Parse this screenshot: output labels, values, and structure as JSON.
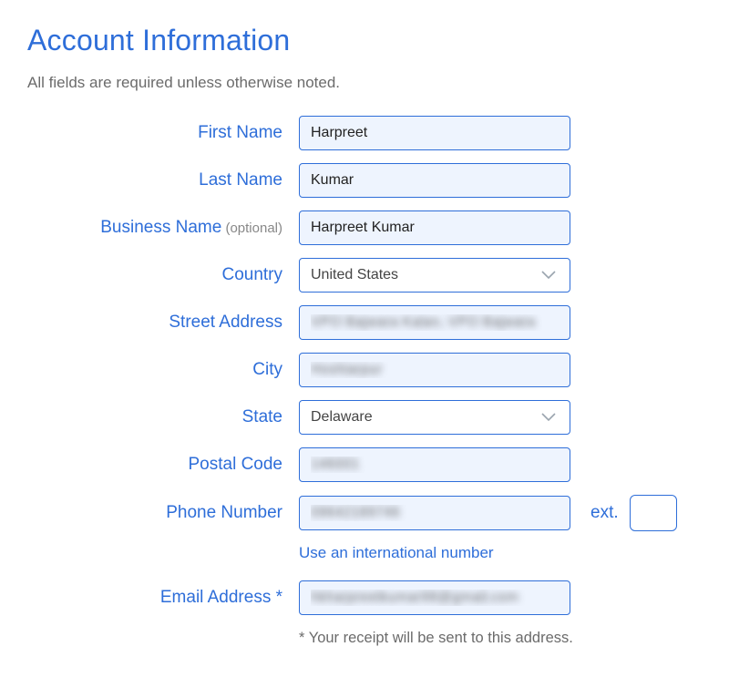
{
  "heading": "Account Information",
  "subheading": "All fields are required unless otherwise noted.",
  "labels": {
    "first_name": "First Name",
    "last_name": "Last Name",
    "business_name": "Business Name",
    "business_optional": " (optional)",
    "country": "Country",
    "street": "Street Address",
    "city": "City",
    "state": "State",
    "postal": "Postal Code",
    "phone": "Phone Number",
    "ext": "ext.",
    "intl_link": "Use an international number",
    "email": "Email Address *",
    "email_note": "* Your receipt will be sent to this address."
  },
  "values": {
    "first_name": "Harpreet",
    "last_name": "Kumar",
    "business_name": "Harpreet Kumar",
    "country": "United States",
    "street": "VPO Bajwara Kalan, VPO Bajwara",
    "city": "Hoshiarpur",
    "state": "Delaware",
    "postal": "146001",
    "phone": "09642189746",
    "ext": "",
    "email": "hkharpreetkumar98@gmail.com"
  }
}
